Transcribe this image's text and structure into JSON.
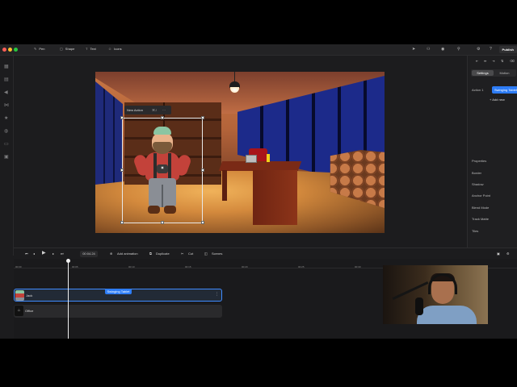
{
  "topbar": {
    "tools": [
      "Pen",
      "Shape",
      "Text",
      "Icons"
    ],
    "publish_label": "Publish"
  },
  "popup": {
    "label": "New Action"
  },
  "right_panel": {
    "tabs": [
      "Settings",
      "Motion"
    ],
    "action_label": "Action 1",
    "action_chip": "Swinging Tablet",
    "add_new": "+ Add new",
    "sections": [
      "Properties",
      "Border",
      "Shadow",
      "Anchor Point",
      "Blend Mode",
      "Track Matte",
      "Tiles"
    ]
  },
  "toolbar": {
    "timecode": "00:04.24",
    "add_animation": "Add animation",
    "duplicate": "Duplicate",
    "cut": "Cut",
    "scenes": "Scenes"
  },
  "timeline": {
    "ticks": [
      "00:00",
      "00:05",
      "00:10",
      "00:15",
      "00:20",
      "00:25",
      "00:30"
    ],
    "tracks": [
      {
        "name": "Jack",
        "chip": "Swinging Tablet"
      },
      {
        "name": "Office"
      }
    ]
  }
}
